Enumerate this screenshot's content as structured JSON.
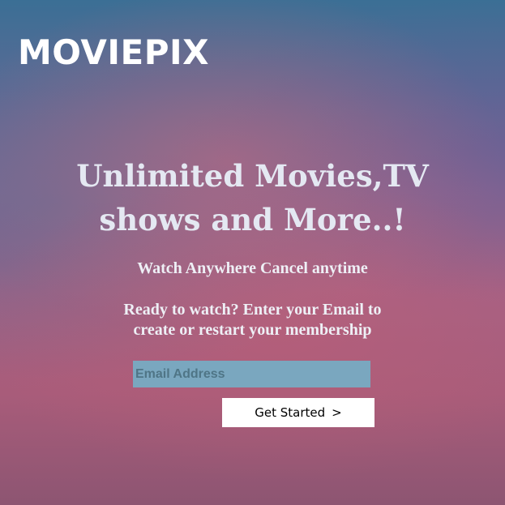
{
  "header": {
    "logo_text": "MOVIEPIX"
  },
  "hero": {
    "title_line1": "Unlimited Movies,TV",
    "title_line2": "shows and More..!",
    "tagline": "Watch Anywhere Cancel anytime",
    "prompt_line1": "Ready to watch? Enter your Email to",
    "prompt_line2": "create or restart your membership"
  },
  "form": {
    "email_placeholder": "Email Address",
    "email_value": "",
    "submit_label": "Get Started",
    "submit_icon": "chevron-right-icon",
    "submit_icon_glyph": ">"
  },
  "colors": {
    "input_background": "#7aa7bf",
    "button_background": "#ffffff",
    "logo_color": "#ffffff"
  }
}
